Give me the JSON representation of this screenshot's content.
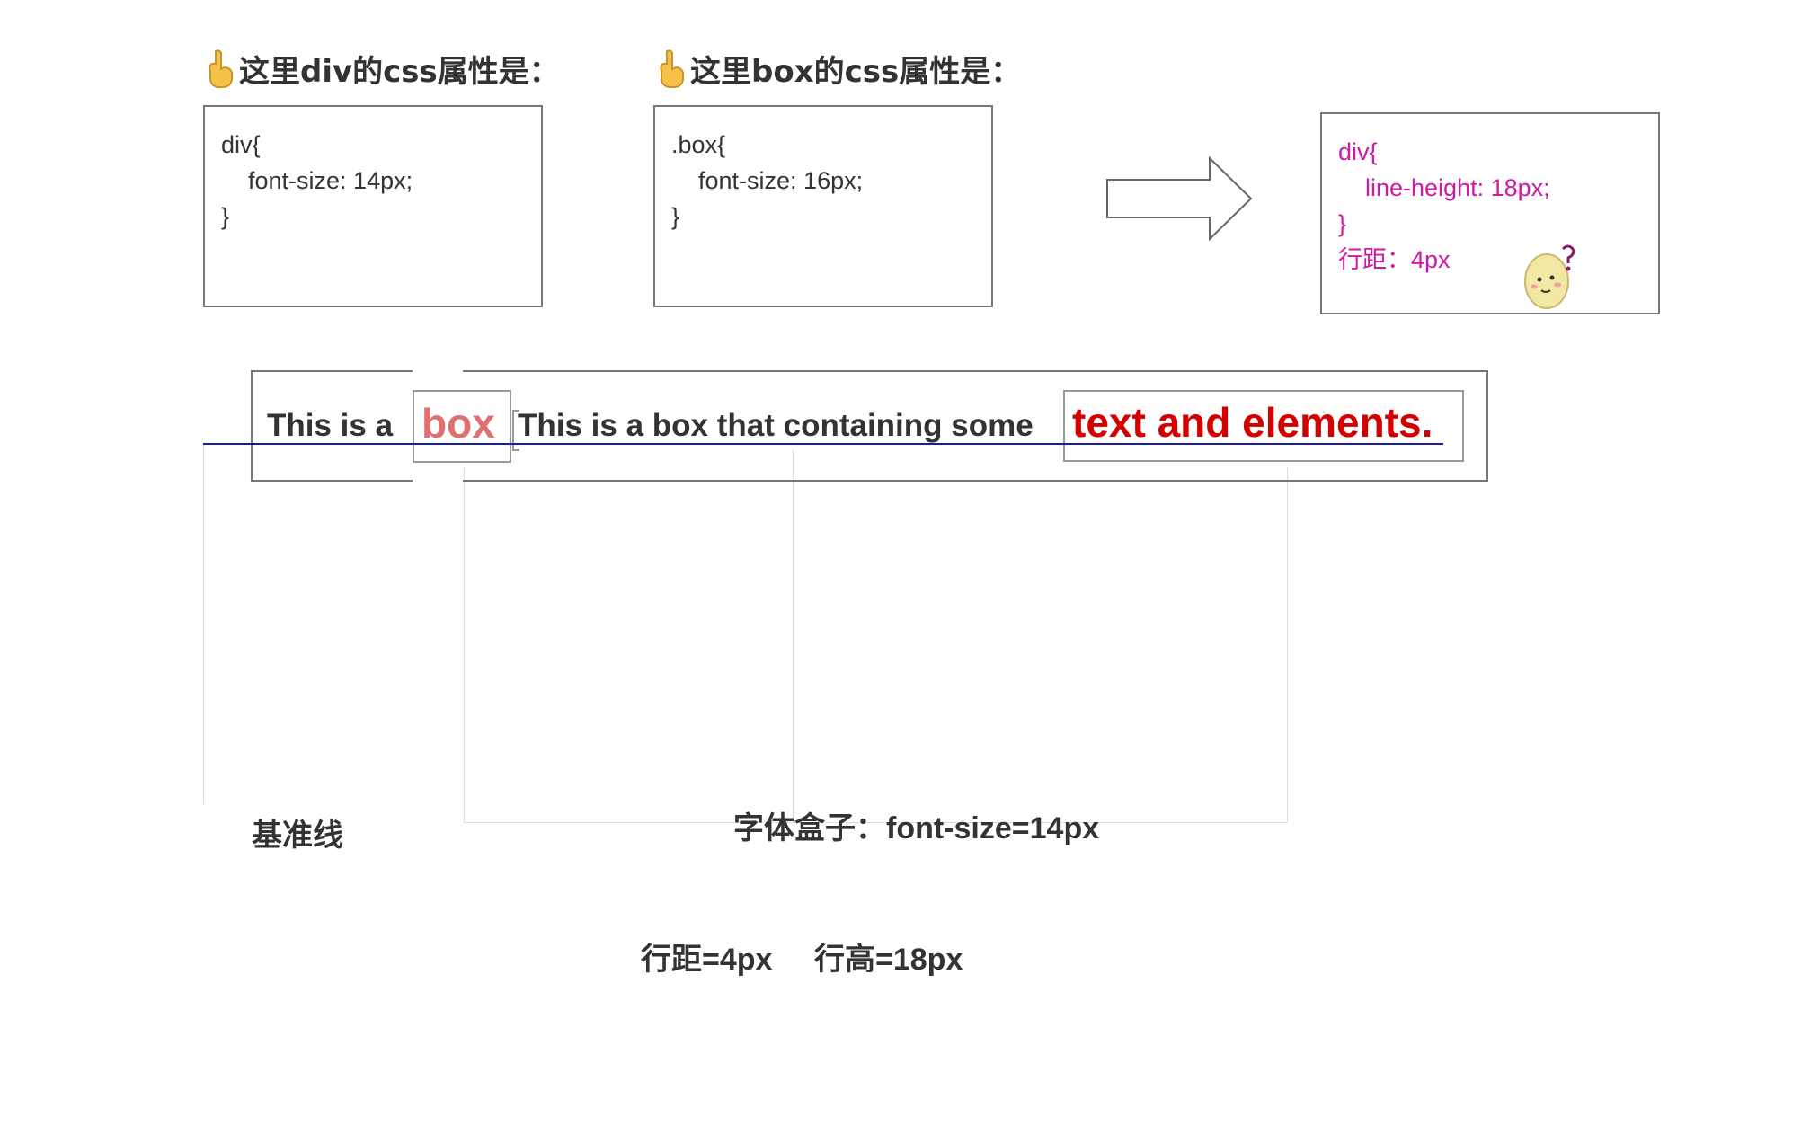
{
  "headings": {
    "div_heading": "这里div的css属性是：",
    "box_heading": "这里box的css属性是："
  },
  "code_div": [
    "div{",
    "    font-size: 14px;",
    "}"
  ],
  "code_box": [
    ".box{",
    "    font-size: 16px;",
    "}"
  ],
  "code_result": [
    "div{",
    "    line-height: 18px;",
    "}",
    "行距：4px"
  ],
  "demo": {
    "text_prefix": "This is a",
    "box_word": "box",
    "text_middle": "This is a box that containing some",
    "red_text": "text and elements."
  },
  "labels": {
    "baseline": "基准线",
    "font_box": "字体盒子：font-size=14px",
    "spacing": "行距=4px",
    "line_height": "行高=18px"
  },
  "colors": {
    "pink": "#d01aa4",
    "red": "#d40000",
    "salmon": "#e07070",
    "baseline_blue": "#1a1aa8"
  },
  "icons": {
    "pointing_hand": "backhand-index-pointing-down-icon",
    "arrow": "right-arrow-icon",
    "mascot": "confused-egg-mascot-icon"
  }
}
